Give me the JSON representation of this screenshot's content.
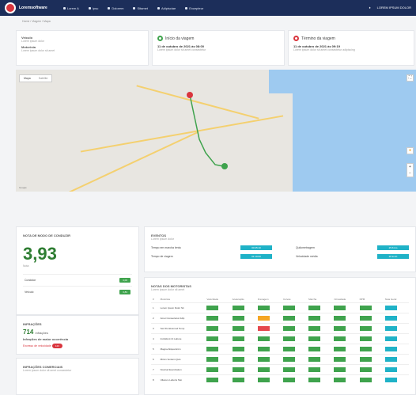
{
  "header": {
    "brand": "Loremsoftware",
    "nav": [
      "Lorem A",
      "Ipsu",
      "Dolorem",
      "Sitamet",
      "Adipisciae",
      "Excepteur"
    ],
    "user": "LOREM IPSUM DOLOR"
  },
  "breadcrumb": "Home / Viagem / Mapa",
  "info1": {
    "label1": "Veículo",
    "val1": "Lorem ipsum dolor",
    "label2": "Motorista",
    "val2": "Lorem ipsum dolor sit amet"
  },
  "start": {
    "title": "Início da viagem",
    "date": "11 de outubro de 2021 às 08:00",
    "sub": "Lorem ipsum dolor sit amet consectetur"
  },
  "end": {
    "title": "Término da viagem",
    "date": "11 de outubro de 2021 às 09:19",
    "sub": "Lorem ipsum dolor sit amet consectetur adipiscing"
  },
  "map": {
    "tab1": "Mapa",
    "tab2": "Satélite",
    "credit": "Google"
  },
  "score": {
    "title": "NOTA DE MODO DE CONDUZIR",
    "value": "3,93",
    "sub": "Nota",
    "rows": [
      {
        "label": "Condutor",
        "badge": "4,00"
      },
      {
        "label": "Veículo",
        "badge": "3,83"
      }
    ]
  },
  "infractions": {
    "title": "INFRAÇÕES",
    "count": "714",
    "count_unit": "infrações",
    "sub": "Infrações de maior ocorrência",
    "tag_label": "Excesso de velocidade",
    "tag": "123"
  },
  "commercial": {
    "title": "INFRAÇÕES COMERCIAIS",
    "sub": "Lorem ipsum dolor sit amet consectetur"
  },
  "events": {
    "title": "EVENTOS",
    "sub": "Lorem ipsum dolor",
    "items": [
      {
        "label": "Tempo em marcha lenta",
        "value": "00:45:10"
      },
      {
        "label": "Quilometragem",
        "value": "25,6 km"
      },
      {
        "label": "Tempo de viagem",
        "value": "01:19:00"
      },
      {
        "label": "Velocidade média",
        "value": "28 km/h"
      }
    ]
  },
  "drivers": {
    "title": "NOTAS DOS MOTORISTAS",
    "sub": "Lorem ipsum dolor sit amet",
    "columns": [
      "#",
      "Motorista",
      "Velocidade",
      "Aceleração",
      "Frenagem",
      "Curvas",
      "Marcha",
      "Ociosidade",
      "RPM",
      "Nota Geral"
    ],
    "rows": [
      [
        "1",
        "Lorem Ipsum Dolor Sit"
      ],
      [
        "2",
        "Amet Consectetur Adip"
      ],
      [
        "3",
        "Sed Do Eiusmod Temp"
      ],
      [
        "4",
        "Incididunt Ut Labore"
      ],
      [
        "5",
        "Magna Aliqua Enim"
      ],
      [
        "6",
        "Minim Veniam Quis"
      ],
      [
        "7",
        "Nostrud Exercitation"
      ],
      [
        "8",
        "Ullamco Laboris Nisi"
      ]
    ]
  }
}
